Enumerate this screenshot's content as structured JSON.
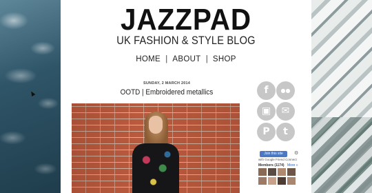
{
  "blog": {
    "title": "JAZZPAD",
    "tagline": "UK FASHION & STYLE BLOG"
  },
  "nav": {
    "items": [
      "HOME",
      "ABOUT",
      "SHOP"
    ],
    "separator": "|"
  },
  "post": {
    "date": "SUNDAY, 2 MARCH 2014",
    "title": "OOTD | Embroidered metallics"
  },
  "social": {
    "icons": [
      "facebook-icon",
      "flickr-icon",
      "instagram-icon",
      "email-icon",
      "pinterest-icon",
      "twitter-icon"
    ],
    "glyphs": [
      "f",
      "●●",
      "▣",
      "✉",
      "P",
      "t"
    ],
    "color": "#c7c7c7"
  },
  "followers": {
    "join_label": "Join this site",
    "provider_note": "with Google Friend Connect",
    "members_label": "Members (1174)",
    "more_label": "More »"
  },
  "colors": {
    "page_bg": "#ffffff",
    "text": "#222222",
    "accent_button": "#4a78c2"
  }
}
